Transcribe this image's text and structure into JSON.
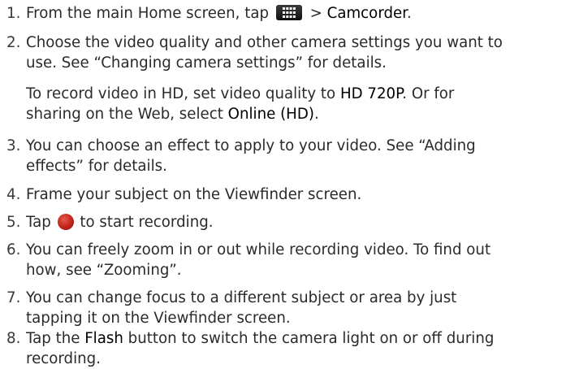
{
  "steps": [
    {
      "num": "1.",
      "pre": "From the main Home screen, tap ",
      "icon": "apps-grid-icon",
      "post": " > ",
      "kw": "Camcorder",
      "end": "."
    },
    {
      "num": "2.",
      "line1": "Choose the video quality and other camera settings you want to",
      "line2": "use. See “Changing camera settings” for details."
    },
    {
      "num": "3.",
      "line1": "You can choose an effect to apply to your video. See “Adding",
      "line2": "effects” for details."
    },
    {
      "num": "4.",
      "line1": "Frame your subject on the Viewfinder screen."
    },
    {
      "num": "5.",
      "pre": "Tap ",
      "icon": "record-button-icon",
      "post": " to start recording."
    },
    {
      "num": "6.",
      "line1": "You can freely zoom in or out while recording video. To find out",
      "line2": "how, see “Zooming”."
    },
    {
      "num": "7.",
      "line1": "You can change focus to a different subject or area by just",
      "line2": "tapping it on the Viewfinder screen."
    },
    {
      "num": "8.",
      "pre": "Tap the ",
      "kw": "Flash",
      "post": " button to switch the camera light on or off during",
      "line2": "recording."
    }
  ],
  "note": {
    "a": "To record video in HD, set video quality to ",
    "kw1": "HD 720P",
    "b": ". Or for",
    "c": "sharing on the Web, select ",
    "kw2": "Online (HD)",
    "d": "."
  }
}
